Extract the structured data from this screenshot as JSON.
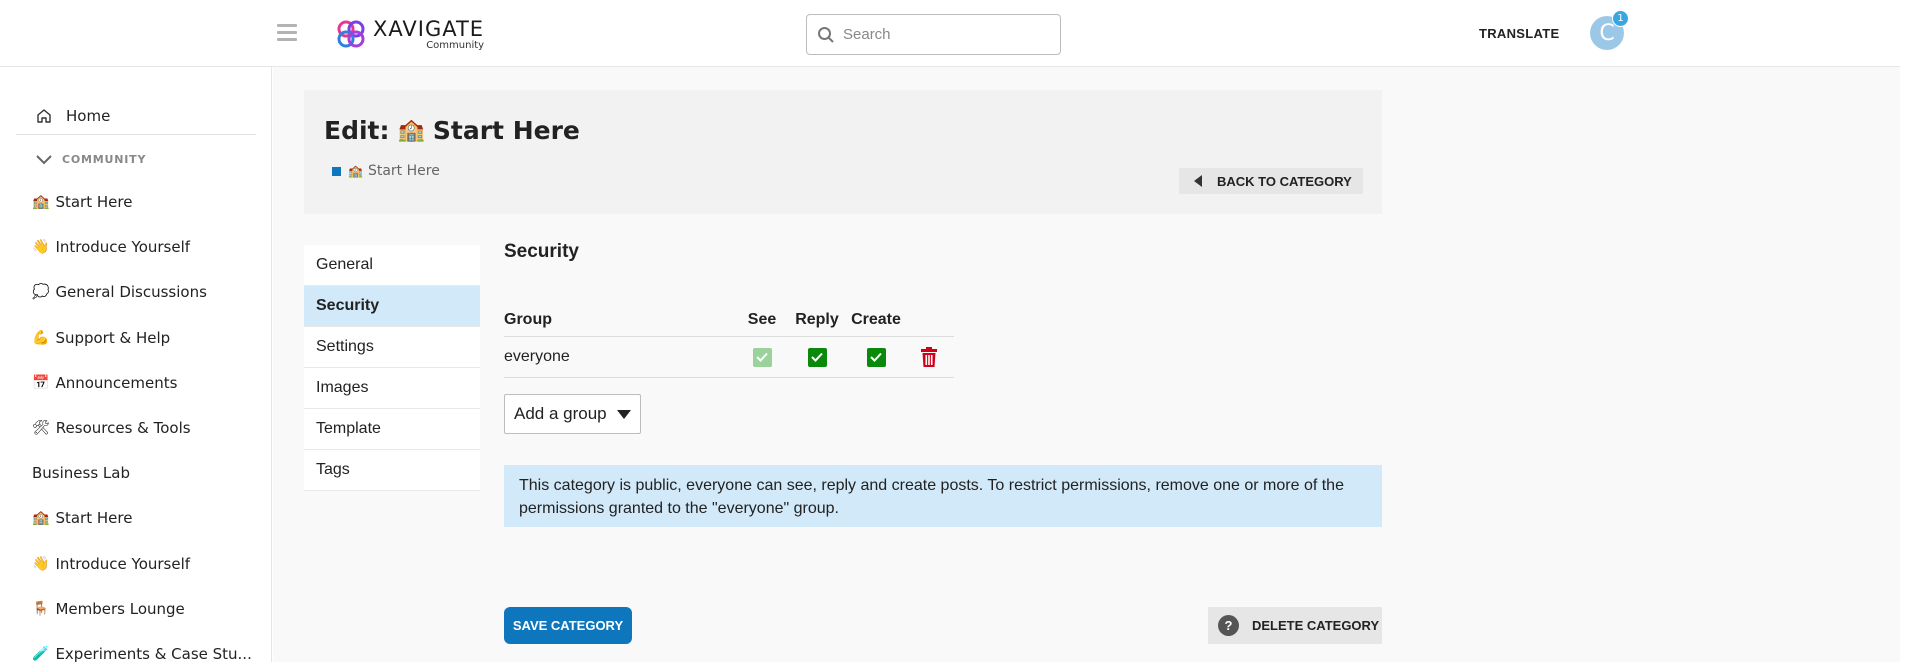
{
  "header": {
    "logo_title": "XAVIGATE",
    "logo_subtitle": "Community",
    "search_placeholder": "Search",
    "translate_label": "TRANSLATE",
    "avatar_initial": "C",
    "notification_count": "1"
  },
  "sidebar": {
    "home_label": "Home",
    "section_label": "COMMUNITY",
    "items": [
      {
        "emoji": "🏫",
        "label": "Start Here"
      },
      {
        "emoji": "👋",
        "label": "Introduce Yourself"
      },
      {
        "emoji": "💭",
        "label": "General Discussions"
      },
      {
        "emoji": "💪",
        "label": "Support & Help"
      },
      {
        "emoji": "📅",
        "label": "Announcements"
      },
      {
        "emoji": "🛠",
        "label": "Resources & Tools"
      },
      {
        "emoji": "",
        "label": "Business Lab"
      },
      {
        "emoji": "🏫",
        "label": "Start Here"
      },
      {
        "emoji": "👋",
        "label": "Introduce Yourself"
      },
      {
        "emoji": "🪑",
        "label": "Members Lounge"
      },
      {
        "emoji": "🧪",
        "label": "Experiments & Case Stu..."
      }
    ]
  },
  "edit": {
    "title_prefix": "Edit:",
    "title_emoji": "🏫",
    "title_name": "Start Here",
    "breadcrumb_emoji": "🏫",
    "breadcrumb": "Start Here",
    "back_label": "BACK TO CATEGORY"
  },
  "tabs": [
    "General",
    "Security",
    "Settings",
    "Images",
    "Template",
    "Tags"
  ],
  "active_tab": "Security",
  "security": {
    "title": "Security",
    "columns": {
      "group": "Group",
      "see": "See",
      "reply": "Reply",
      "create": "Create"
    },
    "rows": [
      {
        "group": "everyone",
        "see": true,
        "reply": true,
        "create": true
      }
    ],
    "add_group_label": "Add a group",
    "info_text": "This category is public, everyone can see, reply and create posts. To restrict permissions, remove one or more of the permissions granted to the \"everyone\" group."
  },
  "actions": {
    "save_label": "SAVE CATEGORY",
    "delete_label": "DELETE CATEGORY"
  },
  "colors": {
    "primary": "#0e76bd",
    "active_tab_bg": "#d1e9f8",
    "check_green": "#0a8a0a",
    "delete_red": "#d0021b"
  }
}
